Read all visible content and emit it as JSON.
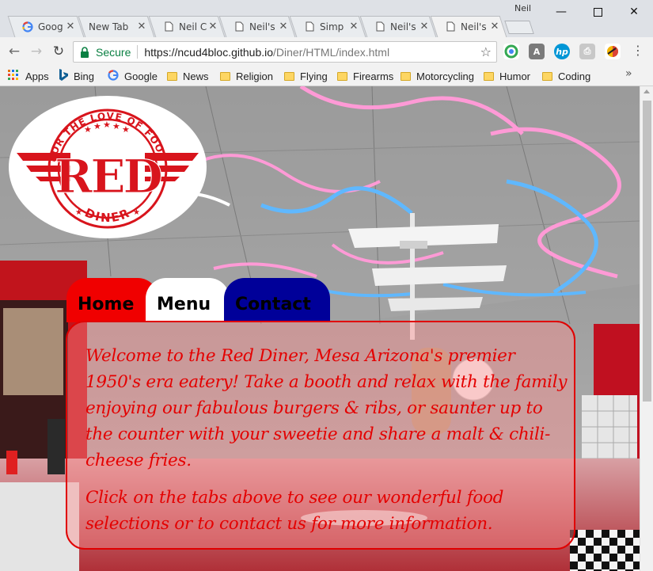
{
  "browser": {
    "profile_name": "Neil",
    "tabs": [
      {
        "title": "Goog",
        "favicon": "google-icon"
      },
      {
        "title": "New Tab",
        "favicon": "none"
      },
      {
        "title": "Neil C",
        "favicon": "page-icon"
      },
      {
        "title": "Neil's",
        "favicon": "page-icon"
      },
      {
        "title": "Simp",
        "favicon": "page-icon"
      },
      {
        "title": "Neil's",
        "favicon": "page-icon"
      },
      {
        "title": "Neil's",
        "favicon": "page-icon",
        "active": true
      }
    ],
    "address": {
      "secure_label": "Secure",
      "url_host": "https://ncud4bloc.github.io",
      "url_path": "/Diner/HTML/index.html"
    },
    "bookmarks": [
      {
        "label": "Apps",
        "icon": "apps-grid-icon"
      },
      {
        "label": "Bing",
        "icon": "bing-icon"
      },
      {
        "label": "Google",
        "icon": "google-icon"
      },
      {
        "label": "News",
        "icon": "folder-icon"
      },
      {
        "label": "Religion",
        "icon": "folder-icon"
      },
      {
        "label": "Flying",
        "icon": "folder-icon"
      },
      {
        "label": "Firearms",
        "icon": "folder-icon"
      },
      {
        "label": "Motorcycling",
        "icon": "folder-icon"
      },
      {
        "label": "Humor",
        "icon": "folder-icon"
      },
      {
        "label": "Coding",
        "icon": "folder-icon"
      }
    ]
  },
  "page": {
    "logo": {
      "arc_text": "FOR THE LOVE OF FOOD",
      "big_word": "RED",
      "bottom_word": "DINER"
    },
    "nav": {
      "home": "Home",
      "menu": "Menu",
      "contact": "Contact"
    },
    "welcome": "Welcome to the Red Diner, Mesa Arizona's premier 1950's era eatery! Take a booth and relax with the family enjoying our fabulous burgers & ribs, or saunter up to the counter with your sweetie and share a malt & chili-cheese fries.",
    "instructions": "Click on the tabs above to see our wonderful food selections or to contact us for more information."
  },
  "colors": {
    "brand_red": "#d8141c",
    "home_tab": "#f00000",
    "contact_tab": "#000099",
    "text_red": "#e40000"
  }
}
